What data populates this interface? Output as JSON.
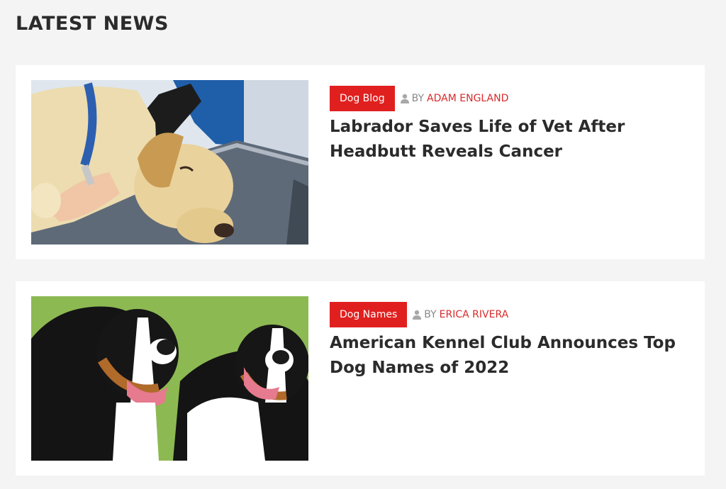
{
  "section": {
    "title": "LATEST NEWS"
  },
  "articles": [
    {
      "category": "Dog Blog",
      "by_label": "BY",
      "author": "ADAM ENGLAND",
      "title": "Labrador Saves Life of Vet After Headbutt Reveals Cancer",
      "image_alt": "Labrador lying on vet examination table"
    },
    {
      "category": "Dog Names",
      "by_label": "BY",
      "author": "ERICA RIVERA",
      "title": "American Kennel Club Announces Top Dog Names of 2022",
      "image_alt": "Two Bernese mountain dogs sitting on grass"
    }
  ],
  "icons": {
    "author": "user-icon"
  },
  "colors": {
    "accent": "#e0201f",
    "author_link": "#d82a2a",
    "heading": "#2b2b2b",
    "background": "#f4f4f4"
  }
}
